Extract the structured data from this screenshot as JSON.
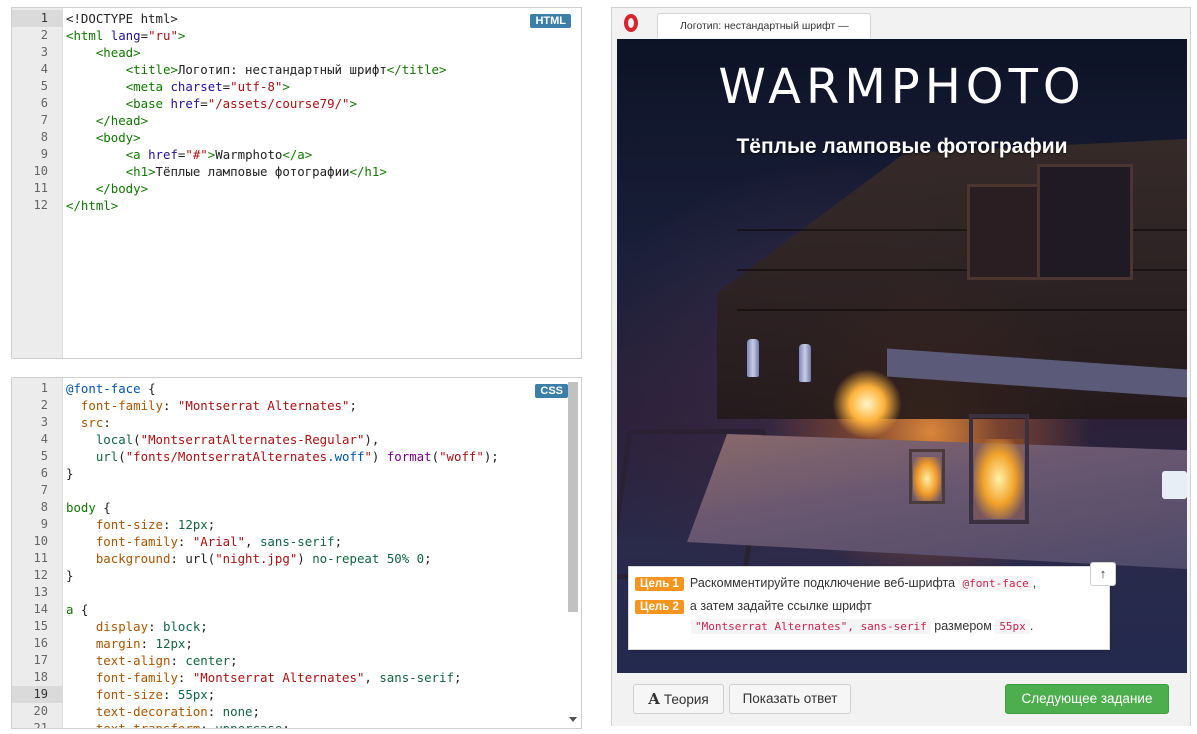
{
  "html_editor": {
    "badge": "HTML",
    "active_line": 1,
    "lines": [
      {
        "n": "1",
        "tokens": [
          [
            "t-txt",
            "<!DOCTYPE html>"
          ]
        ]
      },
      {
        "n": "2",
        "tokens": [
          [
            "t-tag",
            "<html "
          ],
          [
            "t-attr",
            "lang"
          ],
          [
            "t-txt",
            "="
          ],
          [
            "t-str",
            "\"ru\""
          ],
          [
            "t-tag",
            ">"
          ]
        ]
      },
      {
        "n": "3",
        "tokens": [
          [
            "t-txt",
            "    "
          ],
          [
            "t-tag",
            "<head>"
          ]
        ]
      },
      {
        "n": "4",
        "tokens": [
          [
            "t-txt",
            "        "
          ],
          [
            "t-tag",
            "<title>"
          ],
          [
            "t-txt",
            "Логотип: нестандартный шрифт"
          ],
          [
            "t-tag",
            "</title>"
          ]
        ]
      },
      {
        "n": "5",
        "tokens": [
          [
            "t-txt",
            "        "
          ],
          [
            "t-tag",
            "<meta "
          ],
          [
            "t-attr",
            "charset"
          ],
          [
            "t-txt",
            "="
          ],
          [
            "t-str",
            "\"utf-8\""
          ],
          [
            "t-tag",
            ">"
          ]
        ]
      },
      {
        "n": "6",
        "tokens": [
          [
            "t-txt",
            "        "
          ],
          [
            "t-tag",
            "<base "
          ],
          [
            "t-attr",
            "href"
          ],
          [
            "t-txt",
            "="
          ],
          [
            "t-str",
            "\"/assets/course79/\""
          ],
          [
            "t-tag",
            ">"
          ]
        ]
      },
      {
        "n": "7",
        "tokens": [
          [
            "t-txt",
            "    "
          ],
          [
            "t-tag",
            "</head>"
          ]
        ]
      },
      {
        "n": "8",
        "tokens": [
          [
            "t-txt",
            "    "
          ],
          [
            "t-tag",
            "<body>"
          ]
        ]
      },
      {
        "n": "9",
        "tokens": [
          [
            "t-txt",
            "        "
          ],
          [
            "t-tag",
            "<a "
          ],
          [
            "t-attr",
            "href"
          ],
          [
            "t-txt",
            "="
          ],
          [
            "t-str",
            "\"#\""
          ],
          [
            "t-tag",
            ">"
          ],
          [
            "t-txt",
            "Warmphoto"
          ],
          [
            "t-tag",
            "</a>"
          ]
        ]
      },
      {
        "n": "10",
        "tokens": [
          [
            "t-txt",
            "        "
          ],
          [
            "t-tag",
            "<h1>"
          ],
          [
            "t-txt",
            "Тёплые ламповые фотографии"
          ],
          [
            "t-tag",
            "</h1>"
          ]
        ]
      },
      {
        "n": "11",
        "tokens": [
          [
            "t-txt",
            "    "
          ],
          [
            "t-tag",
            "</body>"
          ]
        ]
      },
      {
        "n": "12",
        "tokens": [
          [
            "t-tag",
            "</html>"
          ]
        ]
      }
    ]
  },
  "css_editor": {
    "badge": "CSS",
    "active_line": 19,
    "lines": [
      {
        "n": "1",
        "tokens": [
          [
            "t-def",
            "@font-face"
          ],
          [
            "t-txt",
            " {"
          ]
        ]
      },
      {
        "n": "2",
        "tokens": [
          [
            "t-txt",
            "  "
          ],
          [
            "t-prop",
            "font-family"
          ],
          [
            "t-txt",
            ": "
          ],
          [
            "t-str",
            "\"Montserrat Alternates\""
          ],
          [
            "t-txt",
            ";"
          ]
        ]
      },
      {
        "n": "3",
        "tokens": [
          [
            "t-txt",
            "  "
          ],
          [
            "t-prop",
            "src"
          ],
          [
            "t-txt",
            ":"
          ]
        ]
      },
      {
        "n": "4",
        "tokens": [
          [
            "t-txt",
            "    "
          ],
          [
            "t-val",
            "local"
          ],
          [
            "t-txt",
            "("
          ],
          [
            "t-str",
            "\"MontserratAlternates-Regular\""
          ],
          [
            "t-txt",
            "),"
          ]
        ]
      },
      {
        "n": "5",
        "tokens": [
          [
            "t-txt",
            "    "
          ],
          [
            "t-val",
            "url"
          ],
          [
            "t-txt",
            "("
          ],
          [
            "t-str",
            "\"fonts/MontserratAlternates"
          ],
          [
            "t-def",
            ".woff"
          ],
          [
            "t-str",
            "\""
          ],
          [
            "t-txt",
            ") "
          ],
          [
            "t-kw",
            "format"
          ],
          [
            "t-txt",
            "("
          ],
          [
            "t-str",
            "\"woff\""
          ],
          [
            "t-txt",
            ");"
          ]
        ]
      },
      {
        "n": "6",
        "tokens": [
          [
            "t-txt",
            "}"
          ]
        ]
      },
      {
        "n": "7",
        "tokens": [
          [
            "t-txt",
            ""
          ]
        ]
      },
      {
        "n": "8",
        "tokens": [
          [
            "t-tag",
            "body"
          ],
          [
            "t-txt",
            " {"
          ]
        ]
      },
      {
        "n": "9",
        "tokens": [
          [
            "t-txt",
            "    "
          ],
          [
            "t-prop",
            "font-size"
          ],
          [
            "t-txt",
            ": "
          ],
          [
            "t-num",
            "12px"
          ],
          [
            "t-txt",
            ";"
          ]
        ]
      },
      {
        "n": "10",
        "tokens": [
          [
            "t-txt",
            "    "
          ],
          [
            "t-prop",
            "font-family"
          ],
          [
            "t-txt",
            ": "
          ],
          [
            "t-str",
            "\"Arial\""
          ],
          [
            "t-txt",
            ", "
          ],
          [
            "t-val",
            "sans-serif"
          ],
          [
            "t-txt",
            ";"
          ]
        ]
      },
      {
        "n": "11",
        "tokens": [
          [
            "t-txt",
            "    "
          ],
          [
            "t-prop",
            "background"
          ],
          [
            "t-txt",
            ": "
          ],
          [
            "t-txt",
            "url("
          ],
          [
            "t-str",
            "\"night.jpg\""
          ],
          [
            "t-txt",
            ") "
          ],
          [
            "t-val",
            "no-repeat"
          ],
          [
            "t-txt",
            " "
          ],
          [
            "t-num",
            "50%"
          ],
          [
            "t-txt",
            " "
          ],
          [
            "t-num",
            "0"
          ],
          [
            "t-txt",
            ";"
          ]
        ]
      },
      {
        "n": "12",
        "tokens": [
          [
            "t-txt",
            "}"
          ]
        ]
      },
      {
        "n": "13",
        "tokens": [
          [
            "t-txt",
            ""
          ]
        ]
      },
      {
        "n": "14",
        "tokens": [
          [
            "t-tag",
            "a"
          ],
          [
            "t-txt",
            " {"
          ]
        ]
      },
      {
        "n": "15",
        "tokens": [
          [
            "t-txt",
            "    "
          ],
          [
            "t-prop",
            "display"
          ],
          [
            "t-txt",
            ": "
          ],
          [
            "t-val",
            "block"
          ],
          [
            "t-txt",
            ";"
          ]
        ]
      },
      {
        "n": "16",
        "tokens": [
          [
            "t-txt",
            "    "
          ],
          [
            "t-prop",
            "margin"
          ],
          [
            "t-txt",
            ": "
          ],
          [
            "t-num",
            "12px"
          ],
          [
            "t-txt",
            ";"
          ]
        ]
      },
      {
        "n": "17",
        "tokens": [
          [
            "t-txt",
            "    "
          ],
          [
            "t-prop",
            "text-align"
          ],
          [
            "t-txt",
            ": "
          ],
          [
            "t-val",
            "center"
          ],
          [
            "t-txt",
            ";"
          ]
        ]
      },
      {
        "n": "18",
        "tokens": [
          [
            "t-txt",
            "    "
          ],
          [
            "t-prop",
            "font-family"
          ],
          [
            "t-txt",
            ": "
          ],
          [
            "t-str",
            "\"Montserrat Alternates\""
          ],
          [
            "t-txt",
            ", "
          ],
          [
            "t-val",
            "sans-serif"
          ],
          [
            "t-txt",
            ";"
          ]
        ]
      },
      {
        "n": "19",
        "tokens": [
          [
            "t-txt",
            "    "
          ],
          [
            "t-prop",
            "font-size"
          ],
          [
            "t-txt",
            ": "
          ],
          [
            "t-num",
            "55px"
          ],
          [
            "t-txt",
            ";"
          ]
        ]
      },
      {
        "n": "20",
        "tokens": [
          [
            "t-txt",
            "    "
          ],
          [
            "t-prop",
            "text-decoration"
          ],
          [
            "t-txt",
            ": "
          ],
          [
            "t-val",
            "none"
          ],
          [
            "t-txt",
            ";"
          ]
        ]
      },
      {
        "n": "21",
        "tokens": [
          [
            "t-txt",
            "    "
          ],
          [
            "t-prop",
            "text-transform"
          ],
          [
            "t-txt",
            ": "
          ],
          [
            "t-val",
            "uppercase"
          ],
          [
            "t-txt",
            ";"
          ]
        ]
      }
    ]
  },
  "preview": {
    "tab_title": "Логотип: нестандартный шрифт —",
    "logo_text": "warmphoto",
    "heading": "Тёплые ламповые фотографии"
  },
  "tasks": [
    {
      "label": "Цель 1",
      "text_before": "Раскомментируйте подключение веб-шрифта",
      "code": "@font-face",
      "text_after": ","
    },
    {
      "label": "Цель 2",
      "text_before": "а затем задайте ссылке шрифт",
      "code": "\"Montserrat Alternates\", sans-serif",
      "text_after": "размером",
      "code2": "55px",
      "text_end": "."
    }
  ],
  "collapse_icon": "↑",
  "buttons": {
    "theory_icon": "A",
    "theory": "Теория",
    "show_answer": "Показать ответ",
    "next": "Следующее задание"
  },
  "colors": {
    "accent_green": "#4cae4c",
    "task_orange": "#f5951e",
    "badge_blue": "#3b7fa8",
    "opera_red": "#d9242b"
  }
}
